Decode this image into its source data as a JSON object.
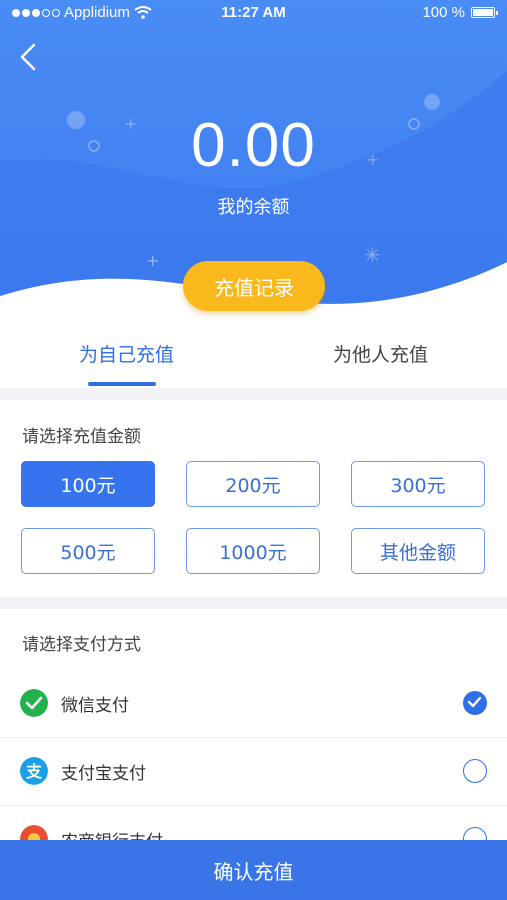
{
  "status_bar": {
    "carrier": "Applidium",
    "time": "11:27 AM",
    "battery": "100 %"
  },
  "header": {
    "balance": "0.00",
    "balance_label": "我的余额",
    "record_button": "充值记录"
  },
  "tabs": [
    {
      "label": "为自己充值",
      "active": true
    },
    {
      "label": "为他人充值",
      "active": false
    }
  ],
  "amount_section": {
    "title": "请选择充值金额",
    "options": [
      "100元",
      "200元",
      "300元",
      "500元",
      "1000元",
      "其他金额"
    ],
    "selected": "100元"
  },
  "payment_section": {
    "title": "请选择支付方式",
    "methods": [
      {
        "label": "微信支付",
        "icon": "wechat-pay-icon",
        "checked": true
      },
      {
        "label": "支付宝支付",
        "icon": "alipay-icon",
        "checked": false
      },
      {
        "label": "农商银行支付",
        "icon": "bank-icon",
        "checked": false
      }
    ]
  },
  "confirm_button": "确认充值",
  "colors": {
    "primary": "#3773ee",
    "header_top": "#4a8cf5",
    "accent": "#f9b81b",
    "background": "#ffffff",
    "separator": "#f2f3f7"
  }
}
